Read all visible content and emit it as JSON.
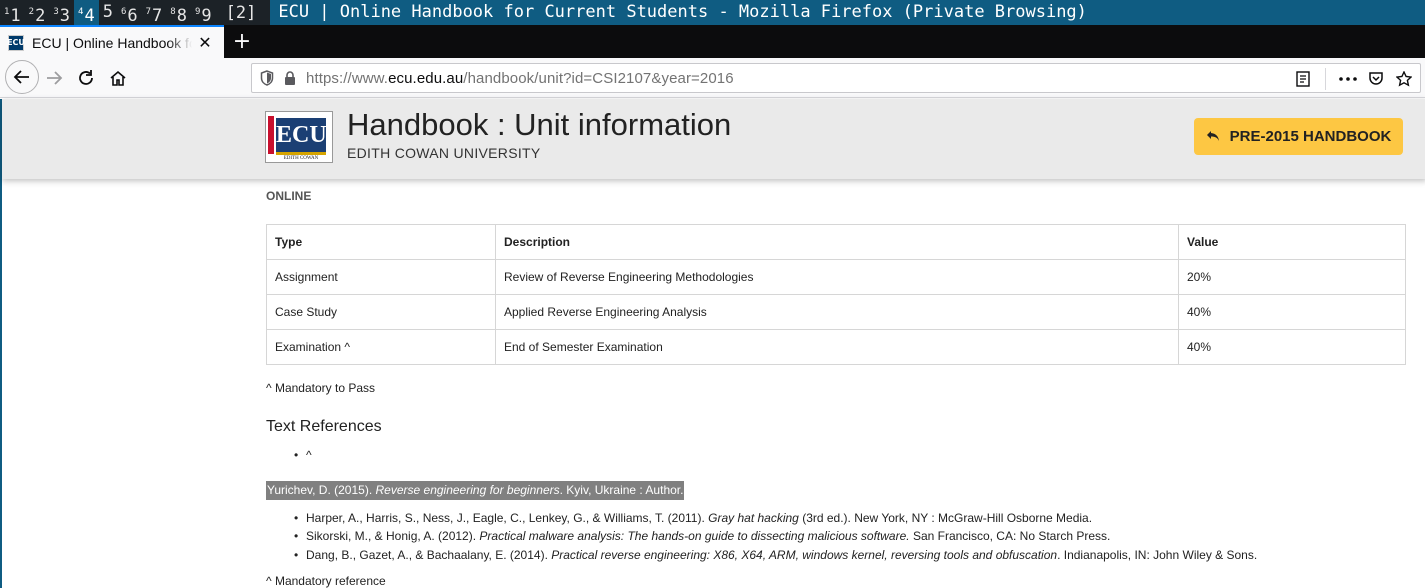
{
  "wm": {
    "workspaces": [
      {
        "num": "1",
        "label": "1"
      },
      {
        "num": "2",
        "label": "2"
      },
      {
        "num": "3",
        "label": "3"
      },
      {
        "num": "4",
        "label": "4"
      },
      {
        "num": "5",
        "label": "5"
      },
      {
        "num": "6",
        "label": "6"
      },
      {
        "num": "7",
        "label": "7"
      },
      {
        "num": "8",
        "label": "8"
      },
      {
        "num": "9",
        "label": "9"
      }
    ],
    "count": "[2]",
    "window_title": "ECU | Online Handbook for Current Students - Mozilla Firefox (Private Browsing)"
  },
  "browser": {
    "tab_title": "ECU | Online Handbook for Current Students",
    "favicon_text": "ECU",
    "url_prefix": "https://www.",
    "url_domain": "ecu.edu.au",
    "url_path": "/handbook/unit?id=CSI2107&year=2016"
  },
  "header": {
    "logo_text": "ECU",
    "logo_sub": "EDITH COWAN",
    "title": "Handbook : Unit information",
    "subtitle": "EDITH COWAN UNIVERSITY",
    "pre2015_label": "PRE-2015 HANDBOOK"
  },
  "main": {
    "mode": "ONLINE",
    "table": {
      "headers": [
        "Type",
        "Description",
        "Value"
      ],
      "rows": [
        [
          "Assignment",
          "Review of Reverse Engineering Methodologies",
          "20%"
        ],
        [
          "Case Study",
          "Applied Reverse Engineering Analysis",
          "40%"
        ],
        [
          "Examination ^",
          "End of Semester Examination",
          "40%"
        ]
      ]
    },
    "mandatory_note": "^ Mandatory to Pass",
    "refs_heading": "Text References",
    "caret": "^",
    "highlighted_ref": {
      "pre": "Yurichev, D. (2015). ",
      "italic": "Reverse engineering for beginners",
      "post": ". Kyiv, Ukraine : Author."
    },
    "references": [
      {
        "pre": "Harper, A., Harris, S., Ness, J., Eagle, C., Lenkey, G., & Williams, T. (2011). ",
        "italic": "Gray hat hacking",
        "post": " (3rd ed.). New York, NY : McGraw-Hill Osborne Media."
      },
      {
        "pre": "Sikorski, M., & Honig, A. (2012). ",
        "italic": "Practical malware analysis: The hands-on guide to dissecting malicious software.",
        "post": " San Francisco, CA: No Starch Press."
      },
      {
        "pre": "Dang, B., Gazet, A., & Bachaalany, E. (2014). ",
        "italic": "Practical reverse engineering: X86, X64, ARM, windows kernel, reversing tools and obfuscation",
        "post": ". Indianapolis, IN: John Wiley & Sons."
      }
    ],
    "mandatory_ref_note": "^ Mandatory reference"
  }
}
